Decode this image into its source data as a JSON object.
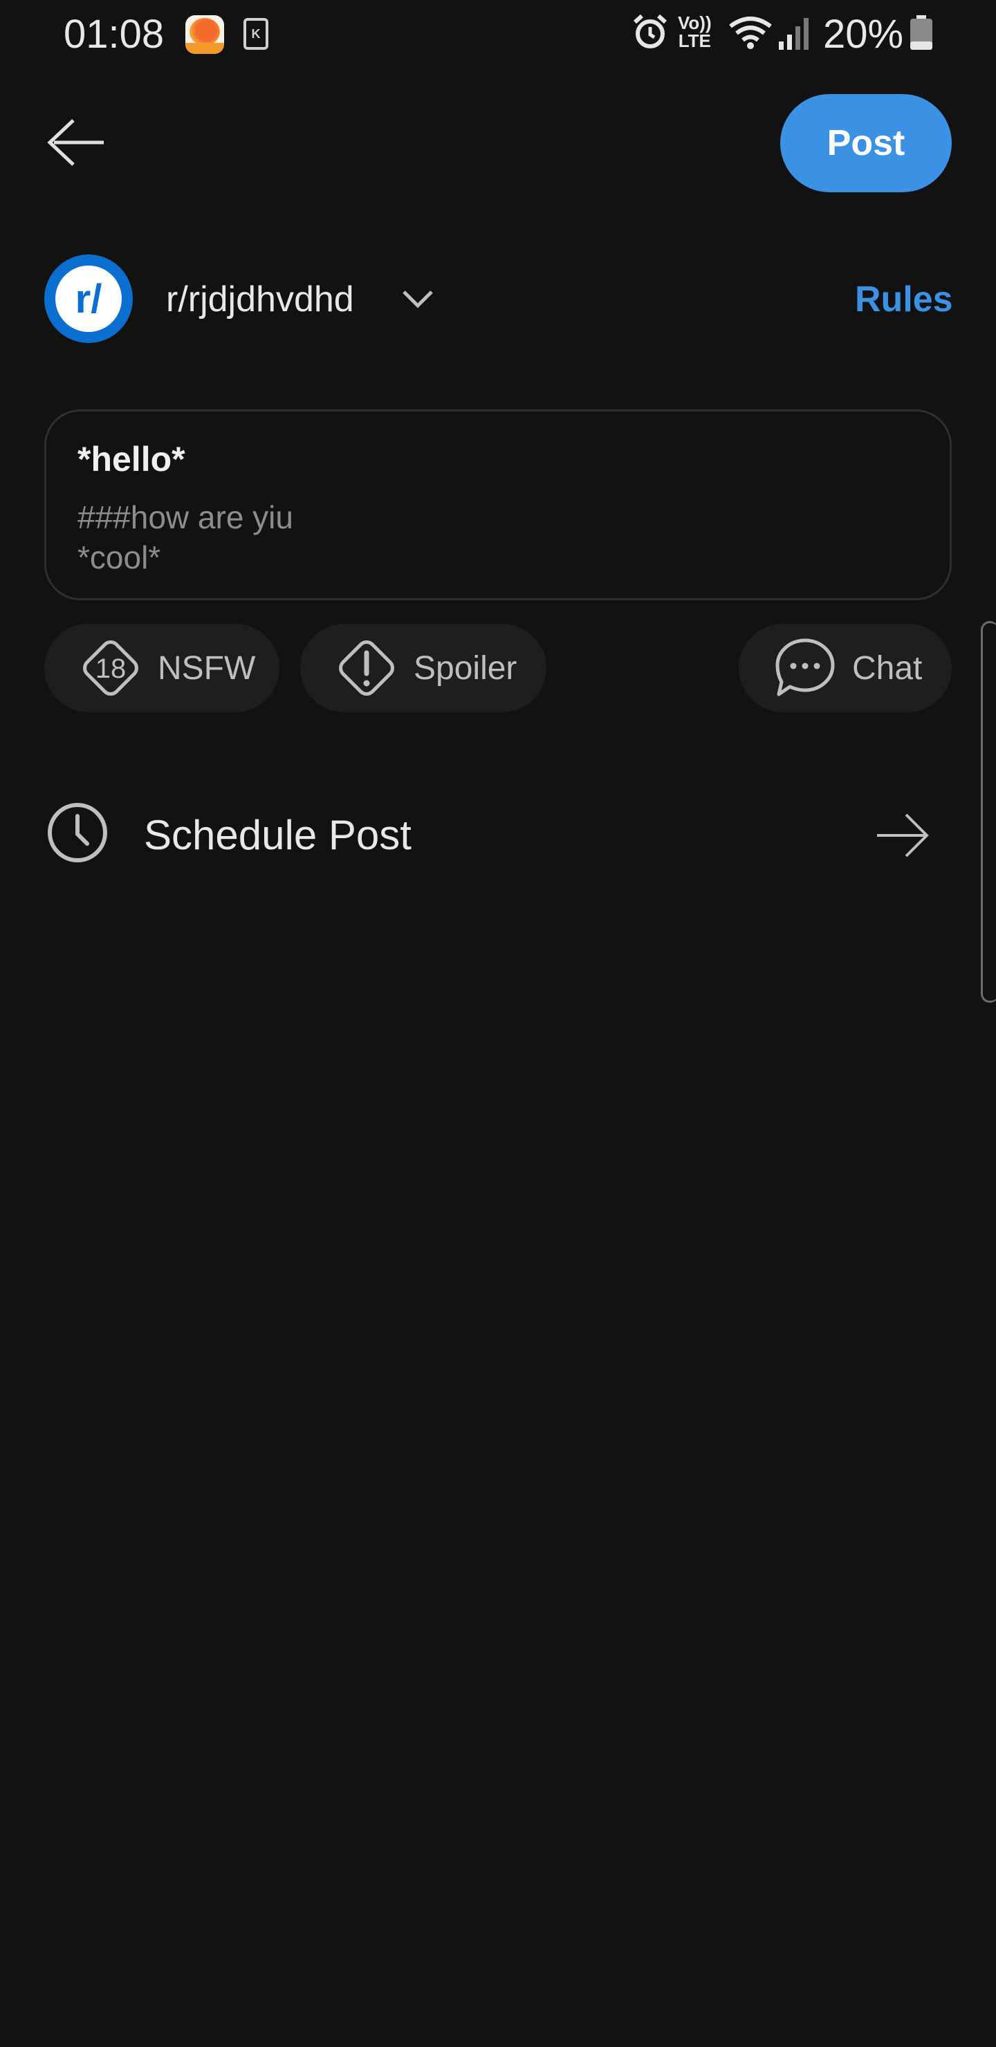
{
  "status_bar": {
    "time": "01:08",
    "volte_top": "Vo))",
    "volte_bottom": "LTE",
    "battery_percent": "20%"
  },
  "toolbar": {
    "post_label": "Post"
  },
  "community": {
    "avatar_text": "r/",
    "name": "r/rjdjdhvdhd",
    "rules_label": "Rules"
  },
  "composer": {
    "title": "*hello*",
    "body_lines": [
      "###how are yiu",
      "*cool*"
    ]
  },
  "tags": {
    "nsfw_badge": "18",
    "nsfw_label": "NSFW",
    "spoiler_label": "Spoiler",
    "chat_label": "Chat"
  },
  "schedule": {
    "label": "Schedule Post"
  },
  "colors": {
    "background": "#121213",
    "accent": "#3b92e4",
    "community_avatar": "#0a6fd0"
  }
}
